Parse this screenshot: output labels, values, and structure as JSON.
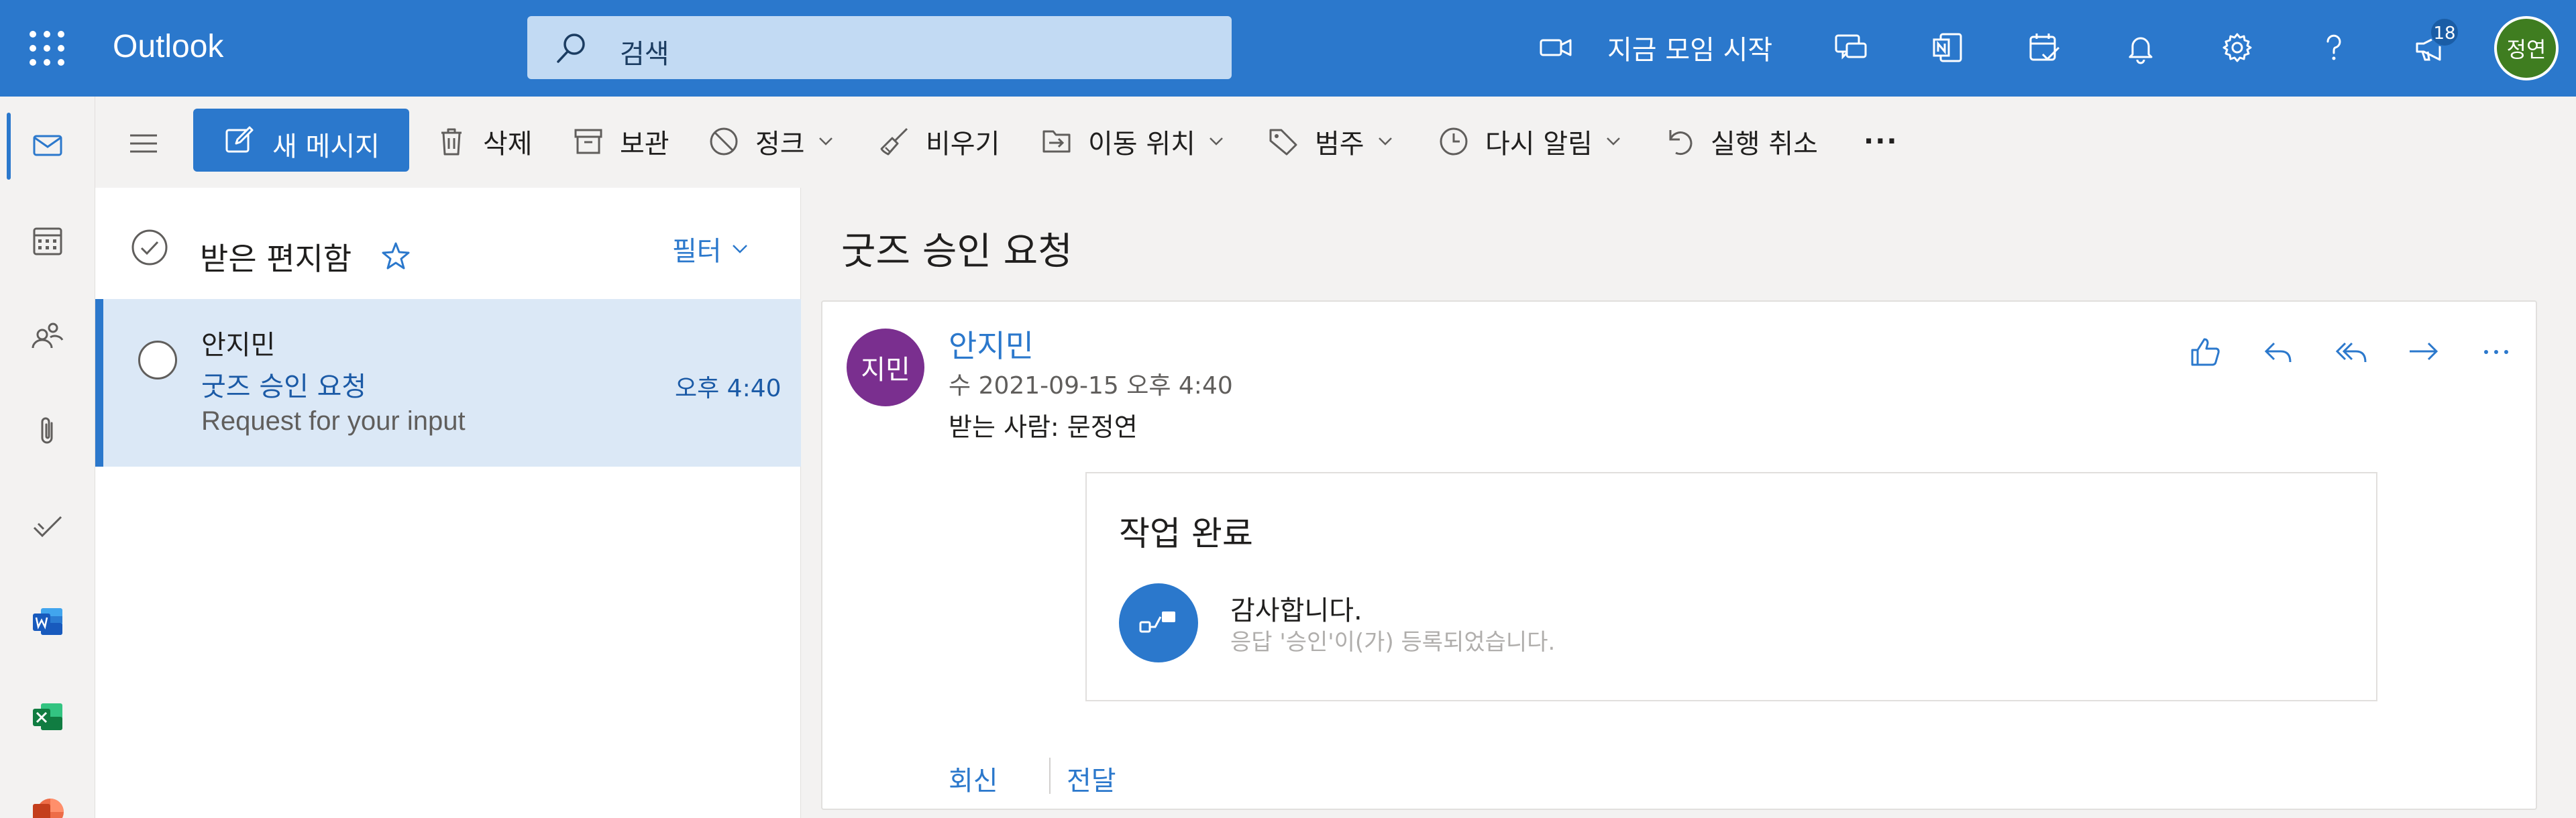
{
  "header": {
    "app_title": "Outlook",
    "search_placeholder": "검색",
    "meet_now_label": "지금 모임 시작",
    "notification_badge": "18",
    "user_initials": "정연",
    "colors": {
      "bar": "#2b78cc",
      "avatar_user": "#3f7d20"
    },
    "icons": [
      "app-launcher-icon",
      "search-icon",
      "video-icon",
      "teams-chat-icon",
      "onenote-icon",
      "my-day-icon",
      "bell-icon",
      "gear-icon",
      "help-icon",
      "megaphone-icon"
    ]
  },
  "rail": {
    "items": [
      "mail-icon",
      "calendar-icon",
      "people-icon",
      "attachment-icon",
      "todo-icon",
      "word-icon",
      "excel-icon",
      "powerpoint-icon"
    ],
    "active": "mail-icon"
  },
  "toolbar": {
    "new_message": "새 메시지",
    "delete": "삭제",
    "archive": "보관",
    "junk": "정크",
    "sweep": "비우기",
    "move_to": "이동 위치",
    "categorize": "범주",
    "snooze": "다시 알림",
    "undo": "실행 취소",
    "more": "···"
  },
  "message_list": {
    "folder_name": "받은 편지함",
    "filter_label": "필터",
    "messages": [
      {
        "sender": "안지민",
        "subject": "굿즈 승인 요청",
        "time": "오후 4:40",
        "preview": "Request for your input"
      }
    ]
  },
  "reading_pane": {
    "subject": "굿즈 승인 요청",
    "sender_initials": "지민",
    "sender_avatar_color": "#7a2f8f",
    "from": "안지민",
    "date": "수 2021-09-15 오후 4:40",
    "to_line": "받는 사람:  문정연",
    "actions": [
      "like-icon",
      "reply-icon",
      "reply-all-icon",
      "forward-icon",
      "more-icon"
    ],
    "card": {
      "title": "작업 완료",
      "message": "감사합니다.",
      "submessage": "응답 '승인'이(가) 등록되었습니다."
    },
    "reply_label": "회신",
    "forward_label": "전달"
  }
}
